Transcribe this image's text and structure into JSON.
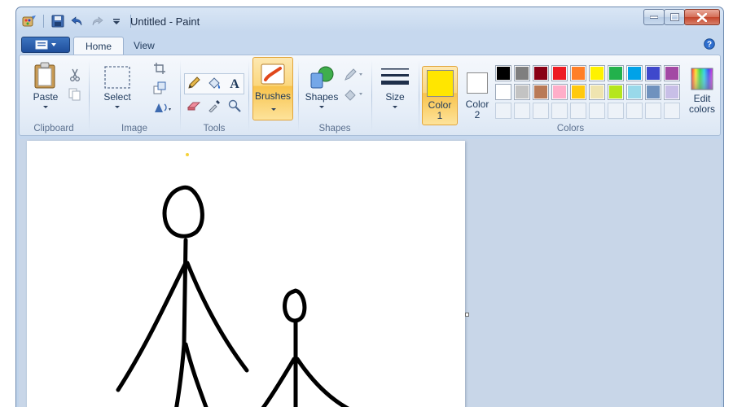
{
  "window": {
    "title": "Untitled - Paint"
  },
  "qat": {
    "icons": [
      "paint-app-icon",
      "save-icon",
      "undo-icon",
      "redo-icon",
      "customize-qat-icon"
    ]
  },
  "tabs": [
    {
      "label": "Home",
      "active": true
    },
    {
      "label": "View",
      "active": false
    }
  ],
  "groups": {
    "clipboard": {
      "label": "Clipboard",
      "paste": "Paste"
    },
    "image": {
      "label": "Image",
      "select": "Select"
    },
    "tools": {
      "label": "Tools"
    },
    "brushes": {
      "label": "Brushes"
    },
    "shapes": {
      "label": "Shapes",
      "shapes_btn": "Shapes"
    },
    "size": {
      "label": "Size"
    },
    "colors": {
      "label": "Colors",
      "color1": {
        "label": "Color\n1",
        "line1": "Color",
        "line2": "1",
        "value": "#ffe600"
      },
      "color2": {
        "label": "Color\n2",
        "line1": "Color",
        "line2": "2",
        "value": "#ffffff"
      },
      "edit": {
        "line1": "Edit",
        "line2": "colors"
      },
      "palette_row1": [
        "#000000",
        "#7f7f7f",
        "#880015",
        "#ed1c24",
        "#ff7f27",
        "#fff200",
        "#22b14c",
        "#00a2e8",
        "#3f48cc",
        "#a349a4"
      ],
      "palette_row2": [
        "#ffffff",
        "#c3c3c3",
        "#b97a57",
        "#ffaec9",
        "#ffc90e",
        "#efe4b0",
        "#b5e61d",
        "#99d9ea",
        "#7092be",
        "#c8bfe7"
      ],
      "palette_row3_count": 10
    }
  },
  "drawing": {
    "stroke_color": "#000000",
    "stroke_width": 5
  }
}
